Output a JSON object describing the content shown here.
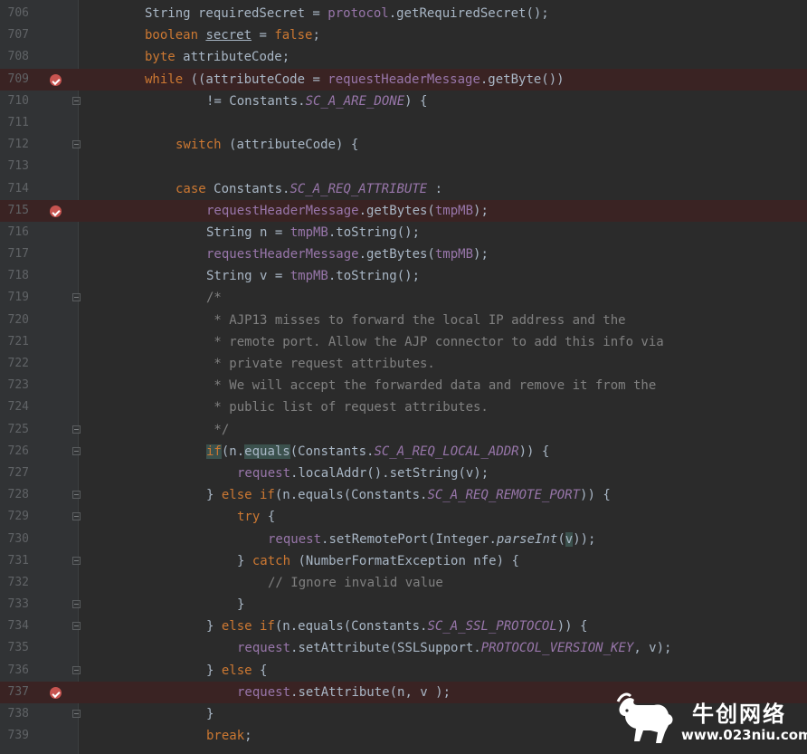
{
  "lines": [
    {
      "n": "706",
      "bp": false,
      "fold": false,
      "ind": 0,
      "tokens": [
        {
          "t": "String requiredSecret = "
        },
        {
          "t": "protocol",
          "c": "fld"
        },
        {
          "t": ".getRequiredSecret();"
        }
      ]
    },
    {
      "n": "707",
      "bp": false,
      "fold": false,
      "ind": 0,
      "tokens": [
        {
          "t": "boolean ",
          "c": "kw"
        },
        {
          "t": "secret",
          "c": "u"
        },
        {
          "t": " = "
        },
        {
          "t": "false",
          "c": "kw"
        },
        {
          "t": ";"
        }
      ]
    },
    {
      "n": "708",
      "bp": false,
      "fold": false,
      "ind": 0,
      "tokens": [
        {
          "t": "byte ",
          "c": "kw"
        },
        {
          "t": "attributeCode;"
        }
      ]
    },
    {
      "n": "709",
      "bp": true,
      "fold": false,
      "ind": 0,
      "tokens": [
        {
          "t": "while ",
          "c": "kw"
        },
        {
          "t": "((attributeCode = "
        },
        {
          "t": "requestHeaderMessage",
          "c": "fld"
        },
        {
          "t": ".getByte())"
        }
      ]
    },
    {
      "n": "710",
      "bp": false,
      "fold": true,
      "ind": 2,
      "tokens": [
        {
          "t": "!= Constants."
        },
        {
          "t": "SC_A_ARE_DONE",
          "c": "cst"
        },
        {
          "t": ") {"
        }
      ]
    },
    {
      "n": "711",
      "bp": false,
      "fold": false,
      "ind": 0,
      "tokens": []
    },
    {
      "n": "712",
      "bp": false,
      "fold": true,
      "ind": 1,
      "tokens": [
        {
          "t": "switch ",
          "c": "kw"
        },
        {
          "t": "(attributeCode) {"
        }
      ]
    },
    {
      "n": "713",
      "bp": false,
      "fold": false,
      "ind": 0,
      "tokens": []
    },
    {
      "n": "714",
      "bp": false,
      "fold": false,
      "ind": 1,
      "tokens": [
        {
          "t": "case ",
          "c": "kw"
        },
        {
          "t": "Constants."
        },
        {
          "t": "SC_A_REQ_ATTRIBUTE",
          "c": "cst"
        },
        {
          "t": " :"
        }
      ]
    },
    {
      "n": "715",
      "bp": true,
      "fold": false,
      "ind": 2,
      "tokens": [
        {
          "t": "requestHeaderMessage",
          "c": "fld"
        },
        {
          "t": ".getBytes("
        },
        {
          "t": "tmpMB",
          "c": "fld"
        },
        {
          "t": ");"
        }
      ]
    },
    {
      "n": "716",
      "bp": false,
      "fold": false,
      "ind": 2,
      "tokens": [
        {
          "t": "String n = "
        },
        {
          "t": "tmpMB",
          "c": "fld"
        },
        {
          "t": ".toString();"
        }
      ]
    },
    {
      "n": "717",
      "bp": false,
      "fold": false,
      "ind": 2,
      "tokens": [
        {
          "t": "requestHeaderMessage",
          "c": "fld"
        },
        {
          "t": ".getBytes("
        },
        {
          "t": "tmpMB",
          "c": "fld"
        },
        {
          "t": ");"
        }
      ]
    },
    {
      "n": "718",
      "bp": false,
      "fold": false,
      "ind": 2,
      "tokens": [
        {
          "t": "String v = "
        },
        {
          "t": "tmpMB",
          "c": "fld"
        },
        {
          "t": ".toString();"
        }
      ]
    },
    {
      "n": "719",
      "bp": false,
      "fold": true,
      "ind": 2,
      "tokens": [
        {
          "t": "/*",
          "c": "cmt"
        }
      ]
    },
    {
      "n": "720",
      "bp": false,
      "fold": false,
      "ind": 2,
      "tokens": [
        {
          "t": " * AJP13 misses to forward the local IP address and the",
          "c": "cmt"
        }
      ]
    },
    {
      "n": "721",
      "bp": false,
      "fold": false,
      "ind": 2,
      "tokens": [
        {
          "t": " * remote port. Allow the AJP connector to add this info via",
          "c": "cmt"
        }
      ]
    },
    {
      "n": "722",
      "bp": false,
      "fold": false,
      "ind": 2,
      "tokens": [
        {
          "t": " * private request attributes.",
          "c": "cmt"
        }
      ]
    },
    {
      "n": "723",
      "bp": false,
      "fold": false,
      "ind": 2,
      "tokens": [
        {
          "t": " * We will accept the forwarded data and remove it from the",
          "c": "cmt"
        }
      ]
    },
    {
      "n": "724",
      "bp": false,
      "fold": false,
      "ind": 2,
      "tokens": [
        {
          "t": " * public list of request attributes.",
          "c": "cmt"
        }
      ]
    },
    {
      "n": "725",
      "bp": false,
      "fold": true,
      "ind": 2,
      "tokens": [
        {
          "t": " */",
          "c": "cmt"
        }
      ]
    },
    {
      "n": "726",
      "bp": false,
      "fold": true,
      "ind": 2,
      "tokens": [
        {
          "t": "if",
          "c": "kw hl"
        },
        {
          "t": "(n."
        },
        {
          "t": "equals",
          "c": "hl"
        },
        {
          "t": "(Constants."
        },
        {
          "t": "SC_A_REQ_LOCAL_ADDR",
          "c": "cst"
        },
        {
          "t": ")) {"
        }
      ]
    },
    {
      "n": "727",
      "bp": false,
      "fold": false,
      "ind": 3,
      "tokens": [
        {
          "t": "request",
          "c": "fld"
        },
        {
          "t": ".localAddr().setString(v);"
        }
      ]
    },
    {
      "n": "728",
      "bp": false,
      "fold": true,
      "ind": 2,
      "tokens": [
        {
          "t": "} "
        },
        {
          "t": "else if",
          "c": "kw"
        },
        {
          "t": "(n.equals(Constants."
        },
        {
          "t": "SC_A_REQ_REMOTE_PORT",
          "c": "cst"
        },
        {
          "t": ")) {"
        }
      ]
    },
    {
      "n": "729",
      "bp": false,
      "fold": true,
      "ind": 3,
      "tokens": [
        {
          "t": "try ",
          "c": "kw"
        },
        {
          "t": "{"
        }
      ]
    },
    {
      "n": "730",
      "bp": false,
      "fold": false,
      "ind": 4,
      "tokens": [
        {
          "t": "request",
          "c": "fld"
        },
        {
          "t": ".setRemotePort(Integer."
        },
        {
          "t": "parseInt",
          "c": "ital"
        },
        {
          "t": "("
        },
        {
          "t": "v",
          "c": "hl"
        },
        {
          "t": "));"
        }
      ]
    },
    {
      "n": "731",
      "bp": false,
      "fold": true,
      "ind": 3,
      "tokens": [
        {
          "t": "} "
        },
        {
          "t": "catch ",
          "c": "kw"
        },
        {
          "t": "(NumberFormatException nfe) {"
        }
      ]
    },
    {
      "n": "732",
      "bp": false,
      "fold": false,
      "ind": 4,
      "tokens": [
        {
          "t": "// Ignore invalid value",
          "c": "cmt"
        }
      ]
    },
    {
      "n": "733",
      "bp": false,
      "fold": true,
      "ind": 3,
      "tokens": [
        {
          "t": "}"
        }
      ]
    },
    {
      "n": "734",
      "bp": false,
      "fold": true,
      "ind": 2,
      "tokens": [
        {
          "t": "} "
        },
        {
          "t": "else if",
          "c": "kw"
        },
        {
          "t": "(n.equals(Constants."
        },
        {
          "t": "SC_A_SSL_PROTOCOL",
          "c": "cst"
        },
        {
          "t": ")) {"
        }
      ]
    },
    {
      "n": "735",
      "bp": false,
      "fold": false,
      "ind": 3,
      "tokens": [
        {
          "t": "request",
          "c": "fld"
        },
        {
          "t": ".setAttribute(SSLSupport."
        },
        {
          "t": "PROTOCOL_VERSION_KEY",
          "c": "cst"
        },
        {
          "t": ", v);"
        }
      ]
    },
    {
      "n": "736",
      "bp": false,
      "fold": true,
      "ind": 2,
      "tokens": [
        {
          "t": "} "
        },
        {
          "t": "else ",
          "c": "kw"
        },
        {
          "t": "{"
        }
      ]
    },
    {
      "n": "737",
      "bp": true,
      "fold": false,
      "ind": 3,
      "tokens": [
        {
          "t": "request",
          "c": "fld"
        },
        {
          "t": ".setAttribute(n, v );"
        }
      ]
    },
    {
      "n": "738",
      "bp": false,
      "fold": true,
      "ind": 2,
      "tokens": [
        {
          "t": "}"
        }
      ]
    },
    {
      "n": "739",
      "bp": false,
      "fold": false,
      "ind": 2,
      "tokens": [
        {
          "t": "break",
          "c": "kw"
        },
        {
          "t": ";"
        }
      ]
    }
  ],
  "watermark": {
    "title": "牛创网络",
    "url": "www.023niu.com",
    "logo_icon": "bull-icon"
  }
}
